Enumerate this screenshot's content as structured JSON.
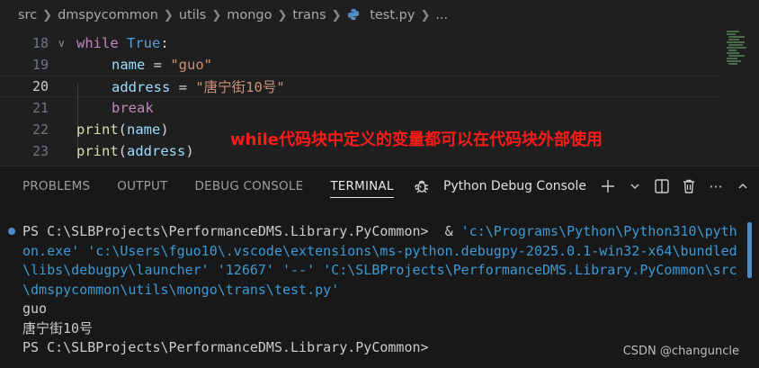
{
  "breadcrumb": {
    "items": [
      "src",
      "dmspycommon",
      "utils",
      "mongo",
      "trans"
    ],
    "file": "test.py",
    "ellipsis": "..."
  },
  "editor": {
    "lines": [
      {
        "num": "18",
        "kw": "while",
        "rest_kw": "True",
        "rest": ":"
      },
      {
        "num": "19",
        "var": "name",
        "op": " = ",
        "str": "\"guo\""
      },
      {
        "num": "20",
        "var": "address",
        "op": " = ",
        "str": "\"唐宁街10号\""
      },
      {
        "num": "21",
        "kw": "break"
      },
      {
        "num": "22",
        "fn": "print",
        "arg": "name"
      },
      {
        "num": "23",
        "fn": "print",
        "arg": "address"
      }
    ],
    "annotation": "while代码块中定义的变量都可以在代码块外部使用"
  },
  "panel": {
    "tabs": [
      "PROBLEMS",
      "OUTPUT",
      "DEBUG CONSOLE",
      "TERMINAL"
    ],
    "active_tab": "TERMINAL",
    "more": "···",
    "console_name": "Python Debug Console"
  },
  "terminal": {
    "prompt1": "PS C:\\SLBProjects\\PerformanceDMS.Library.PyCommon>",
    "cmd_amp": "  & ",
    "cmd_l1": "'c:\\Programs\\Python\\Python310\\pyth",
    "cmd_l2a": "on.exe'",
    "cmd_l2b": " 'c:\\Users\\fguo10\\.vscode\\extensions\\ms-python.debugpy-2025.0.1-win32-x64\\bundled",
    "cmd_l3": "\\libs\\debugpy\\launcher' '12667' '--' 'C:\\SLBProjects\\PerformanceDMS.Library.PyCommon\\src",
    "cmd_l4": "\\dmspycommon\\utils\\mongo\\trans\\test.py'",
    "out1": "guo",
    "out2": "唐宁街10号",
    "prompt2": "PS C:\\SLBProjects\\PerformanceDMS.Library.PyCommon>"
  },
  "watermark": "CSDN @changuncle",
  "colors": {
    "accent": "#3b9ad6",
    "annotation": "#ff1a1a",
    "keyword": "#c586c0"
  }
}
